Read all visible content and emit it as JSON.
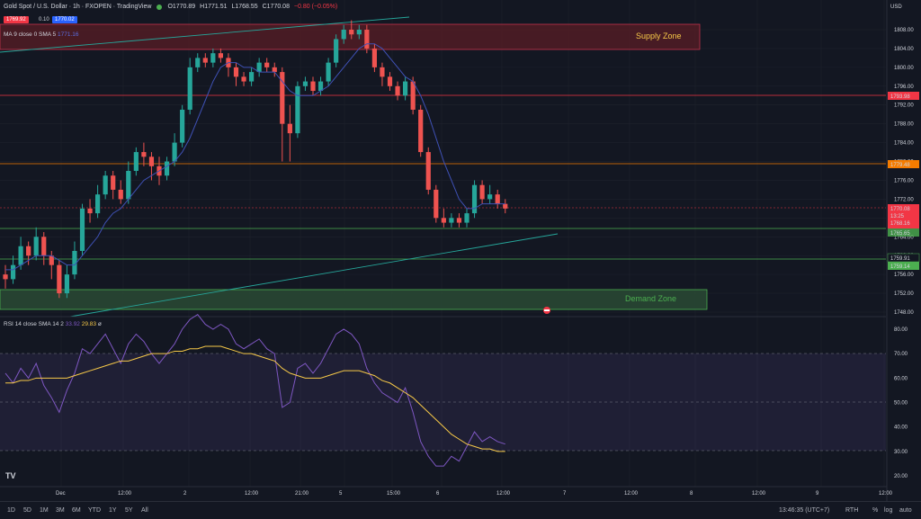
{
  "header": {
    "symbol": "Gold Spot / U.S. Dollar · 1h · FXOPEN · TradingView",
    "bid": "1769.92",
    "spread": "0.10",
    "ask": "1770.02",
    "open": "O1770.89",
    "high": "H1771.51",
    "low": "L1768.55",
    "close": "C1770.08",
    "change": "−0.80 (−0.05%)"
  },
  "indicators": {
    "ma_label": "MA 9 close 0 SMA 5",
    "ma_value": "1771.16",
    "rsi_label": "RSI 14 close SMA 14 2",
    "rsi_value": "33.92",
    "rsi_sma_value": "29.83",
    "rsi_extra": "ø"
  },
  "currency": "USD",
  "zones": {
    "supply": "Supply Zone",
    "demand": "Demand Zone"
  },
  "price_axis": [
    "1808.00",
    "1804.00",
    "1800.00",
    "1796.00",
    "1792.00",
    "1788.00",
    "1784.00",
    "1780.00",
    "1776.00",
    "1772.00",
    "1768.00",
    "1764.00",
    "1760.00",
    "1756.00",
    "1752.00",
    "1748.00"
  ],
  "rsi_axis": [
    "80.00",
    "70.00",
    "60.00",
    "50.00",
    "40.00",
    "30.00",
    "20.00"
  ],
  "price_tags": {
    "t1793": "1793.98",
    "t1779": "1779.48",
    "tlast": "1770.08",
    "tcountdown": "13:25",
    "tlow": "1768.16",
    "t1765": "1765.65",
    "t1759a": "1759.91",
    "t1759b": "1759.14"
  },
  "time_axis": [
    "Dec",
    "12:00",
    "2",
    "12:00",
    "21:00",
    "5",
    "15:00",
    "6",
    "12:00",
    "7",
    "12:00",
    "8",
    "12:00",
    "9",
    "12:00"
  ],
  "bottom": {
    "timeframes": [
      "1D",
      "5D",
      "1M",
      "3M",
      "6M",
      "YTD",
      "1Y",
      "5Y",
      "All"
    ],
    "clock": "13:46:35 (UTC+7)",
    "session": "RTH",
    "pct": "%",
    "log": "log",
    "auto": "auto"
  },
  "colors": {
    "up": "#26a69a",
    "down": "#ef5350",
    "ma": "#3f51b5",
    "rsi": "#7e57c2",
    "rsi_sma": "#f7c948"
  },
  "chart_data": {
    "type": "candlestick",
    "candles": [
      [
        1756,
        1755,
        1758,
        1753
      ],
      [
        1755,
        1758,
        1760,
        1754
      ],
      [
        1758,
        1762,
        1764,
        1757
      ],
      [
        1762,
        1760,
        1763,
        1758
      ],
      [
        1760,
        1764,
        1766,
        1759
      ],
      [
        1764,
        1760,
        1765,
        1758
      ],
      [
        1760,
        1758,
        1761,
        1755
      ],
      [
        1758,
        1752,
        1759,
        1751
      ],
      [
        1752,
        1756,
        1758,
        1751
      ],
      [
        1756,
        1761,
        1763,
        1755
      ],
      [
        1761,
        1770,
        1771,
        1760
      ],
      [
        1770,
        1769,
        1772,
        1767
      ],
      [
        1769,
        1773,
        1775,
        1768
      ],
      [
        1773,
        1777,
        1778,
        1772
      ],
      [
        1777,
        1774,
        1778,
        1772
      ],
      [
        1774,
        1772,
        1776,
        1771
      ],
      [
        1772,
        1778,
        1780,
        1771
      ],
      [
        1778,
        1782,
        1783,
        1777
      ],
      [
        1782,
        1781,
        1784,
        1779
      ],
      [
        1781,
        1779,
        1782,
        1776
      ],
      [
        1779,
        1777,
        1781,
        1775
      ],
      [
        1777,
        1780,
        1781,
        1776
      ],
      [
        1780,
        1784,
        1786,
        1779
      ],
      [
        1784,
        1791,
        1792,
        1783
      ],
      [
        1791,
        1800,
        1802,
        1790
      ],
      [
        1800,
        1802,
        1803,
        1799
      ],
      [
        1802,
        1801,
        1803,
        1800
      ],
      [
        1801,
        1803,
        1804,
        1800
      ],
      [
        1803,
        1802,
        1804,
        1801
      ],
      [
        1802,
        1800,
        1803,
        1798
      ],
      [
        1800,
        1798,
        1801,
        1796
      ],
      [
        1798,
        1797,
        1799,
        1796
      ],
      [
        1797,
        1799,
        1800,
        1796
      ],
      [
        1799,
        1801,
        1802,
        1798
      ],
      [
        1801,
        1800,
        1802,
        1799
      ],
      [
        1800,
        1799,
        1801,
        1798
      ],
      [
        1799,
        1788,
        1800,
        1780
      ],
      [
        1788,
        1786,
        1792,
        1780
      ],
      [
        1786,
        1796,
        1797,
        1785
      ],
      [
        1796,
        1797,
        1798,
        1795
      ],
      [
        1797,
        1795,
        1798,
        1794
      ],
      [
        1795,
        1797,
        1798,
        1794
      ],
      [
        1797,
        1801,
        1802,
        1796
      ],
      [
        1801,
        1806,
        1807,
        1800
      ],
      [
        1806,
        1808,
        1809,
        1805
      ],
      [
        1808,
        1807,
        1810,
        1806
      ],
      [
        1807,
        1808,
        1809,
        1806
      ],
      [
        1808,
        1804,
        1809,
        1803
      ],
      [
        1804,
        1800,
        1805,
        1799
      ],
      [
        1800,
        1798,
        1801,
        1796
      ],
      [
        1798,
        1796,
        1799,
        1795
      ],
      [
        1796,
        1794,
        1797,
        1793
      ],
      [
        1794,
        1797,
        1798,
        1793
      ],
      [
        1797,
        1791,
        1798,
        1790
      ],
      [
        1791,
        1782,
        1792,
        1781
      ],
      [
        1782,
        1774,
        1783,
        1773
      ],
      [
        1774,
        1768,
        1775,
        1767
      ],
      [
        1768,
        1767,
        1770,
        1766
      ],
      [
        1767,
        1768,
        1769,
        1766
      ],
      [
        1768,
        1767,
        1769,
        1766
      ],
      [
        1767,
        1769,
        1770,
        1766
      ],
      [
        1769,
        1775,
        1776,
        1768
      ],
      [
        1775,
        1772,
        1776,
        1771
      ],
      [
        1772,
        1773,
        1775,
        1771
      ],
      [
        1773,
        1771,
        1774,
        1770
      ],
      [
        1771,
        1770,
        1772,
        1769
      ]
    ],
    "ma": [
      1757,
      1757,
      1758,
      1759,
      1760,
      1760,
      1760,
      1759,
      1758,
      1758,
      1760,
      1762,
      1764,
      1767,
      1769,
      1770,
      1772,
      1774,
      1776,
      1777,
      1778,
      1779,
      1780,
      1782,
      1785,
      1789,
      1793,
      1797,
      1800,
      1801,
      1801,
      1800,
      1800,
      1799,
      1799,
      1799,
      1797,
      1795,
      1794,
      1794,
      1794,
      1795,
      1796,
      1798,
      1800,
      1802,
      1804,
      1805,
      1805,
      1804,
      1802,
      1800,
      1798,
      1797,
      1794,
      1790,
      1785,
      1780,
      1776,
      1772,
      1770,
      1770,
      1771,
      1771,
      1771,
      1771
    ],
    "rsi": [
      62,
      58,
      64,
      60,
      66,
      57,
      52,
      46,
      55,
      62,
      72,
      70,
      74,
      78,
      72,
      66,
      74,
      78,
      75,
      70,
      66,
      70,
      74,
      80,
      84,
      86,
      82,
      80,
      82,
      80,
      74,
      72,
      74,
      76,
      72,
      70,
      48,
      50,
      64,
      66,
      62,
      66,
      72,
      78,
      80,
      78,
      74,
      64,
      58,
      54,
      52,
      50,
      56,
      46,
      34,
      28,
      24,
      24,
      28,
      26,
      32,
      38,
      34,
      36,
      34,
      33
    ],
    "rsi_sma": [
      58,
      58,
      59,
      59,
      60,
      60,
      60,
      60,
      60,
      61,
      62,
      63,
      64,
      65,
      66,
      67,
      67,
      68,
      69,
      70,
      70,
      70,
      71,
      71,
      72,
      72,
      73,
      73,
      73,
      72,
      71,
      70,
      70,
      69,
      68,
      67,
      64,
      62,
      61,
      60,
      60,
      60,
      61,
      62,
      63,
      63,
      63,
      62,
      61,
      59,
      58,
      56,
      54,
      52,
      49,
      46,
      43,
      40,
      37,
      35,
      33,
      32,
      31,
      31,
      30,
      30
    ]
  }
}
